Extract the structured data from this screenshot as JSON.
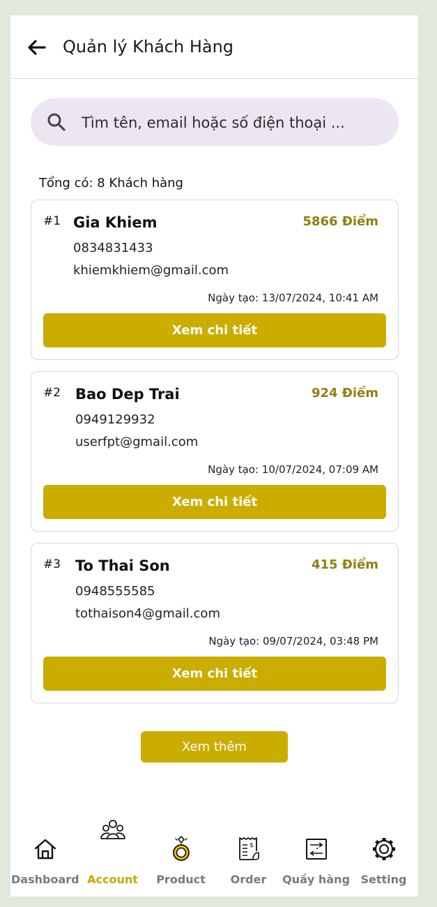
{
  "header": {
    "title": "Quản lý Khách Hàng"
  },
  "search": {
    "placeholder": "Tìm tên, email hoặc số điện thoại ..."
  },
  "summary": {
    "total_text": "Tổng có: 8 Khách hàng"
  },
  "customers": [
    {
      "index": "#1",
      "name": "Gia Khiem",
      "points": "5866 Điểm",
      "phone": "0834831433",
      "email": "khiemkhiem@gmail.com",
      "created": "Ngày tạo: 13/07/2024, 10:41 AM",
      "button": "Xem chi tiết"
    },
    {
      "index": "#2",
      "name": "Bao Dep Trai",
      "points": "924 Điểm",
      "phone": "0949129932",
      "email": "userfpt@gmail.com",
      "created": "Ngày tạo: 10/07/2024, 07:09 AM",
      "button": "Xem chi tiết"
    },
    {
      "index": "#3",
      "name": "To Thai Son",
      "points": "415 Điểm",
      "phone": "0948555585",
      "email": "tothaison4@gmail.com",
      "created": "Ngày tạo: 09/07/2024, 03:48 PM",
      "button": "Xem chi tiết"
    }
  ],
  "load_more": {
    "label": "Xem thêm"
  },
  "nav": {
    "active_color": "#c7a900",
    "items": [
      {
        "label": "Dashboard",
        "icon": "home-icon"
      },
      {
        "label": "Account",
        "icon": "users-icon",
        "active": true
      },
      {
        "label": "Product",
        "icon": "ring-icon"
      },
      {
        "label": "Order",
        "icon": "receipt-icon"
      },
      {
        "label": "Quầy hàng",
        "icon": "counter-icon"
      },
      {
        "label": "Setting",
        "icon": "gear-icon"
      }
    ]
  },
  "colors": {
    "accent": "#cbad00",
    "points_text": "#8f8010",
    "search_bg": "#ece6f3",
    "page_bg": "#e1e9da"
  }
}
